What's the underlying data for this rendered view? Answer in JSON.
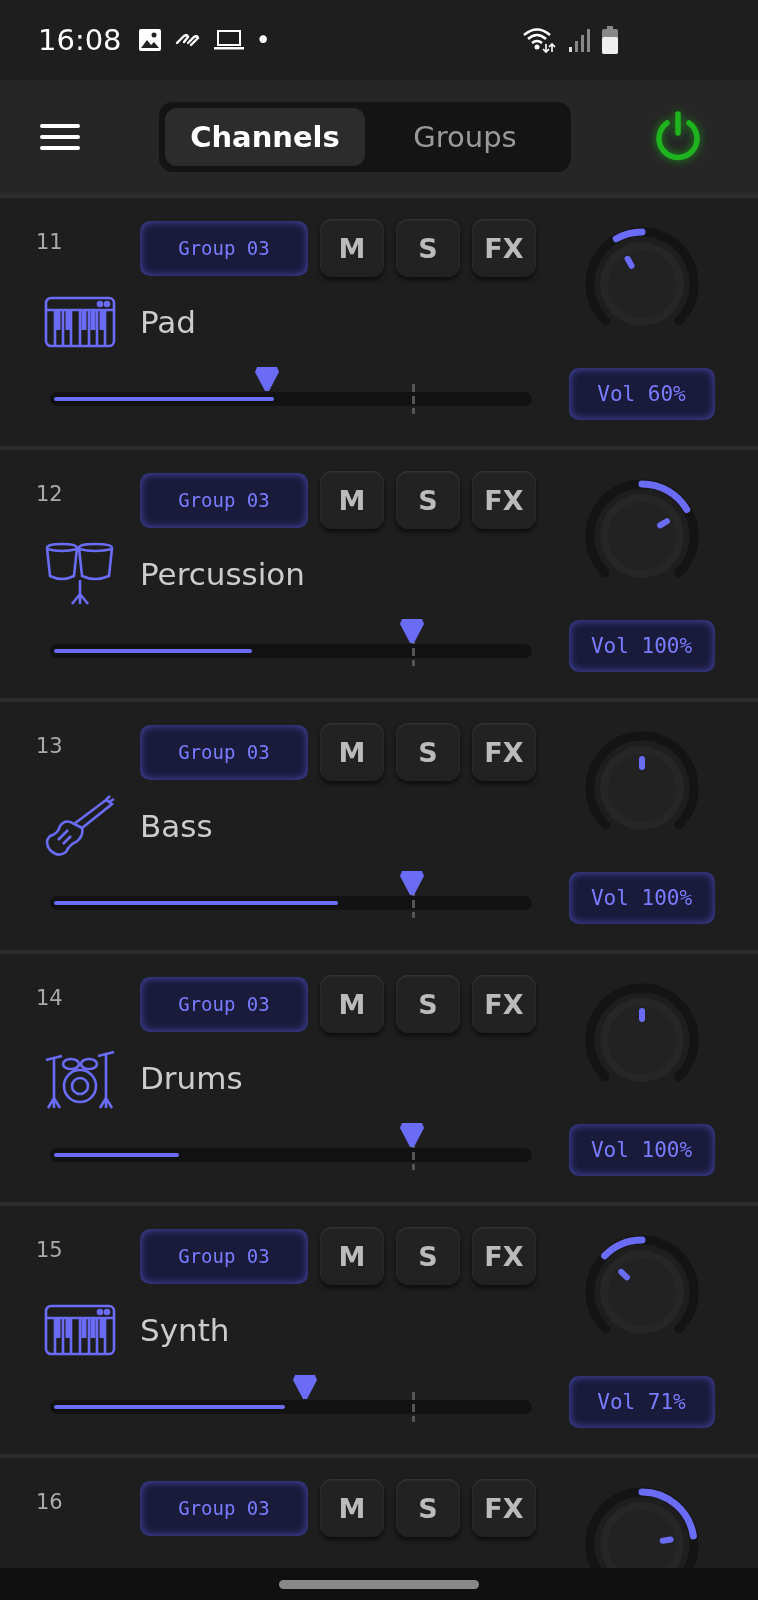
{
  "status_bar": {
    "time": "16:08",
    "dot": "•"
  },
  "header": {
    "tabs": [
      {
        "label": "Channels",
        "selected": true
      },
      {
        "label": "Groups",
        "selected": false
      }
    ],
    "power": {
      "on": true
    }
  },
  "channels": [
    {
      "number": "11",
      "group": "Group 03",
      "buttons": [
        "M",
        "S",
        "FX"
      ],
      "kind": "keys",
      "name": "Pad",
      "fader": {
        "level": 0.45
      },
      "meter": {
        "level": 0.457
      },
      "pan": {
        "level": 0.39
      },
      "volume": "Vol 60%"
    },
    {
      "number": "12",
      "group": "Group 03",
      "buttons": [
        "M",
        "S",
        "FX"
      ],
      "kind": "percussion",
      "name": "Percussion",
      "fader": {
        "level": 0.75
      },
      "meter": {
        "level": 0.41
      },
      "pan": {
        "level": 0.72
      },
      "volume": "Vol 100%"
    },
    {
      "number": "13",
      "group": "Group 03",
      "buttons": [
        "M",
        "S",
        "FX"
      ],
      "kind": "bass",
      "name": "Bass",
      "fader": {
        "level": 0.75
      },
      "meter": {
        "level": 0.59
      },
      "pan": {
        "level": 0.5
      },
      "volume": "Vol 100%"
    },
    {
      "number": "14",
      "group": "Group 03",
      "buttons": [
        "M",
        "S",
        "FX"
      ],
      "kind": "drums",
      "name": "Drums",
      "fader": {
        "level": 0.75
      },
      "meter": {
        "level": 0.26
      },
      "pan": {
        "level": 0.5
      },
      "volume": "Vol 100%"
    },
    {
      "number": "15",
      "group": "Group 03",
      "buttons": [
        "M",
        "S",
        "FX"
      ],
      "kind": "keys",
      "name": "Synth",
      "fader": {
        "level": 0.53
      },
      "meter": {
        "level": 0.48
      },
      "pan": {
        "level": 0.33
      },
      "volume": "Vol 71%"
    },
    {
      "number": "16",
      "group": "Group 03",
      "buttons": [
        "M",
        "S",
        "FX"
      ],
      "pan": {
        "level": 0.8
      }
    }
  ]
}
